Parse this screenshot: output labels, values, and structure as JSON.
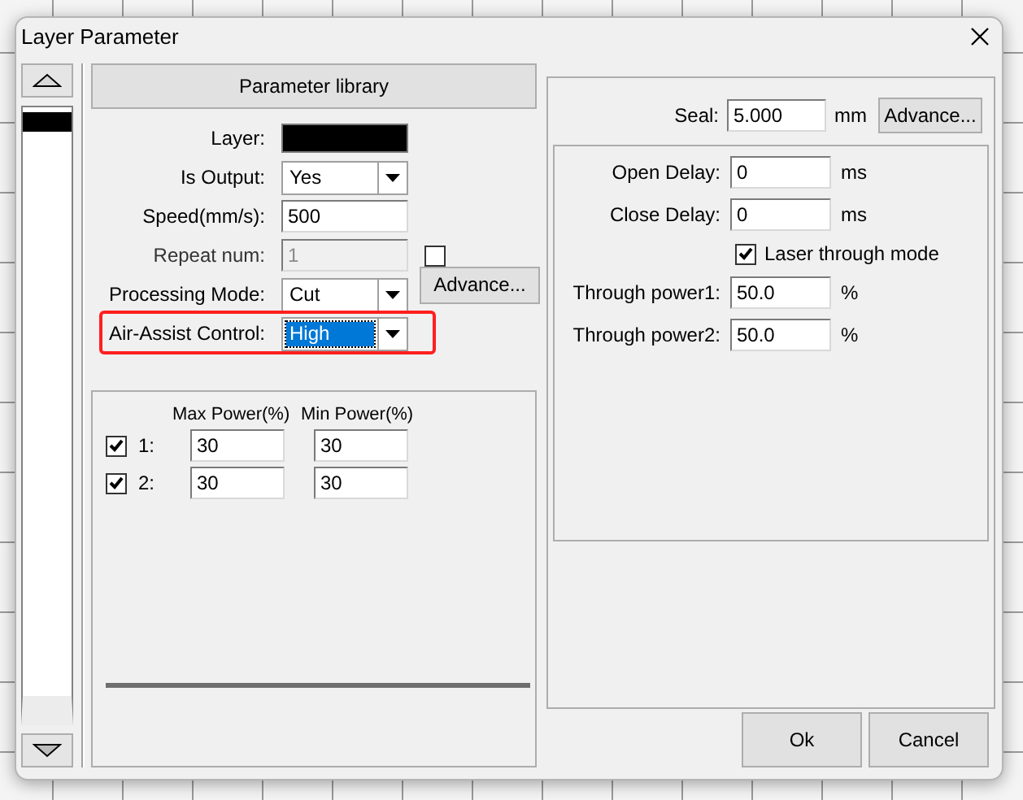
{
  "window": {
    "title": "Layer Parameter"
  },
  "layers": [
    {
      "color": "#000000"
    }
  ],
  "parameter_library": "Parameter library",
  "fields": [
    {
      "kind": "color",
      "label": "Layer:",
      "color": "#000000",
      "disabled": false,
      "highlighted": false
    },
    {
      "kind": "select",
      "label": "Is Output:",
      "value": "Yes",
      "disabled": false,
      "highlighted": false,
      "focused": false
    },
    {
      "kind": "input",
      "label": "Speed(mm/s):",
      "value": "500",
      "disabled": false,
      "highlighted": false
    },
    {
      "kind": "input",
      "label": "Repeat num:",
      "value": "1",
      "disabled": true,
      "highlighted": false,
      "checkbox": {
        "checked": false
      }
    },
    {
      "kind": "select",
      "label": "Processing Mode:",
      "value": "Cut",
      "disabled": false,
      "highlighted": false,
      "focused": false,
      "button": "Advance..."
    },
    {
      "kind": "select",
      "label": "Air-Assist Control:",
      "value": "High",
      "disabled": false,
      "highlighted": true,
      "focused": true
    }
  ],
  "power": {
    "headers": [
      "Max Power(%)",
      "Min Power(%)"
    ],
    "rows": [
      {
        "checked": true,
        "label": "1:",
        "max": "30",
        "min": "30"
      },
      {
        "checked": true,
        "label": "2:",
        "max": "30",
        "min": "30"
      }
    ]
  },
  "seal": {
    "label": "Seal:",
    "value": "5.000",
    "unit": "mm",
    "button": "Advance..."
  },
  "delays": [
    {
      "kind": "input",
      "label": "Open Delay:",
      "value": "0",
      "unit": "ms"
    },
    {
      "kind": "input",
      "label": "Close Delay:",
      "value": "0",
      "unit": "ms"
    },
    {
      "kind": "checkbox",
      "label": "Laser through mode",
      "checked": true
    },
    {
      "kind": "input",
      "label": "Through power1:",
      "value": "50.0",
      "unit": "%"
    },
    {
      "kind": "input",
      "label": "Through power2:",
      "value": "50.0",
      "unit": "%"
    }
  ],
  "buttons": [
    "Ok",
    "Cancel"
  ]
}
